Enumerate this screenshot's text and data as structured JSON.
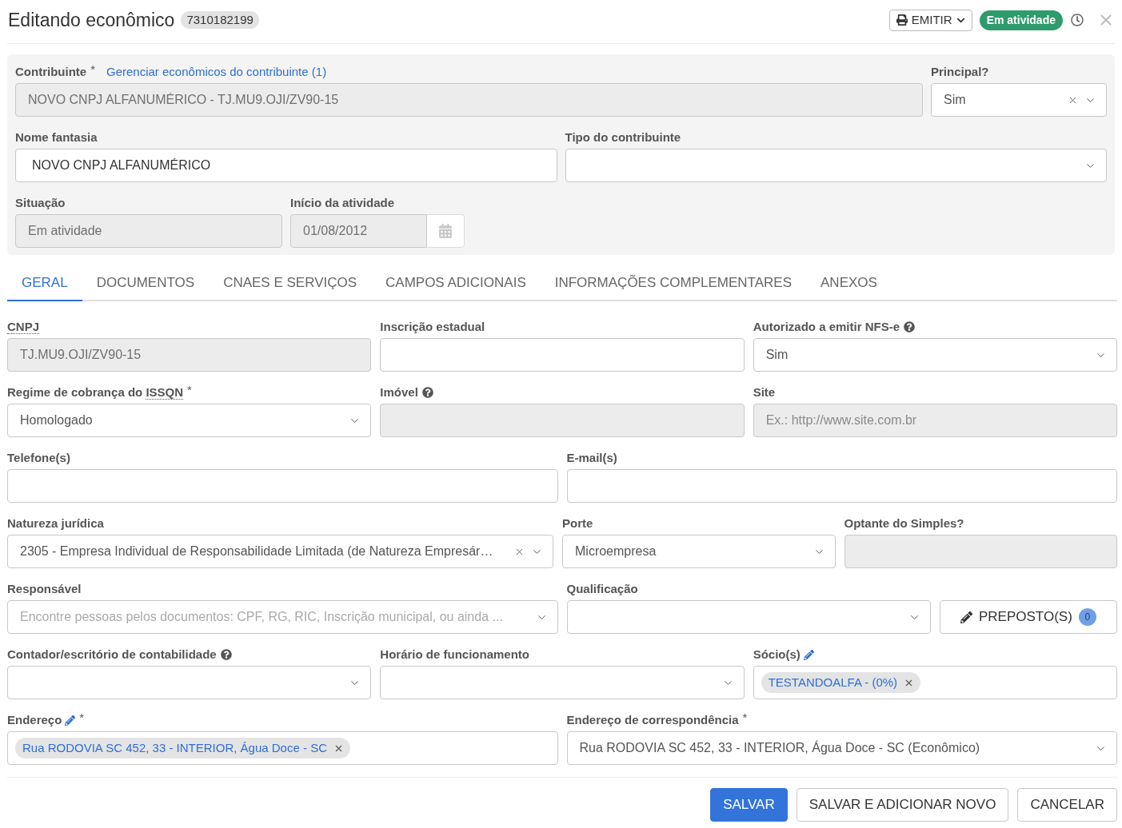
{
  "header": {
    "title": "Editando econômico",
    "record_number": "7310182199",
    "emit_button": "EMITIR",
    "status": "Em atividade"
  },
  "summary_panel": {
    "rows": [
      [
        {
          "kind": "text",
          "label": "Contribuinte",
          "required_mark": "*",
          "link": "Gerenciar econômicos do contribuinte (1)",
          "value": "NOVO CNPJ ALFANUMÉRICO - TJ.MU9.OJI/ZV90-15",
          "disabled": true
        },
        {
          "kind": "select",
          "label": "Principal?",
          "value": "Sim",
          "clearable": true,
          "disabled": false
        }
      ],
      [
        {
          "kind": "text",
          "label": "Nome fantasia",
          "value": "NOVO CNPJ ALFANUMÉRICO",
          "disabled": false
        },
        {
          "kind": "select",
          "label": "Tipo do contribuinte",
          "clearable": false,
          "disabled": false
        }
      ],
      [
        {
          "kind": "text",
          "label": "Situação",
          "value": "Em atividade",
          "disabled": true
        },
        {
          "kind": "date",
          "label": "Início da atividade",
          "value": "01/08/2012",
          "disabled": true
        }
      ]
    ]
  },
  "tabs": [
    {
      "label": "GERAL",
      "selected": true
    },
    {
      "label": "DOCUMENTOS",
      "selected": false
    },
    {
      "label": "CNAES E SERVIÇOS",
      "selected": false
    },
    {
      "label": "CAMPOS ADICIONAIS",
      "selected": false
    },
    {
      "label": "INFORMAÇÕES COMPLEMENTARES",
      "selected": false
    },
    {
      "label": "ANEXOS",
      "selected": false
    }
  ],
  "form": {
    "rows": [
      [
        {
          "kind": "text",
          "abbr": "CNPJ",
          "value": "TJ.MU9.OJI/ZV90-15",
          "disabled": true
        },
        {
          "kind": "text",
          "label": "Inscrição estadual",
          "disabled": false
        },
        {
          "kind": "select",
          "label": "Autorizado a emitir NFS-e",
          "help": true,
          "value": "Sim",
          "clearable": false,
          "disabled": false
        }
      ],
      [
        {
          "kind": "select",
          "label": "Regime de cobrança do",
          "abbr": "ISSQN",
          "required_mark": "*",
          "value": "Homologado",
          "clearable": false,
          "disabled": false
        },
        {
          "kind": "text",
          "label": "Imóvel",
          "help": true,
          "disabled": true
        },
        {
          "kind": "text",
          "label": "Site",
          "placeholder": "Ex.: http://www.site.com.br",
          "disabled": true
        }
      ],
      [
        {
          "kind": "text",
          "label": "Telefone(s)",
          "disabled": false
        },
        {
          "kind": "text",
          "label": "E-mail(s)",
          "disabled": false
        }
      ],
      [
        {
          "kind": "select",
          "label": "Natureza jurídica",
          "value": "2305 - Empresa Individual de Responsabilidade Limitada (de Natureza Empresár…",
          "clearable": true,
          "disabled": false
        },
        {
          "kind": "select",
          "label": "Porte",
          "value": "Microempresa",
          "clearable": false,
          "disabled": false
        },
        {
          "kind": "text",
          "label": "Optante do Simples?",
          "disabled": true
        }
      ],
      [
        {
          "kind": "select",
          "label": "Responsável",
          "placeholder": "Encontre pessoas pelos documentos: CPF, RG, RIC, Inscrição municipal, ou ainda ...",
          "clearable": false,
          "disabled": false
        },
        {
          "kind": "select",
          "label": "Qualificação",
          "clearable": false,
          "disabled": false
        },
        {
          "kind": "button",
          "text": "PREPOSTO(S)",
          "count": "0"
        }
      ],
      [
        {
          "kind": "select",
          "label": "Contador/escritório de contabilidade",
          "help": true,
          "clearable": false,
          "disabled": false
        },
        {
          "kind": "select",
          "label": "Horário de funcionamento",
          "clearable": false,
          "disabled": false
        },
        {
          "kind": "tags",
          "label": "Sócio(s)",
          "edit": true,
          "tags": [
            "TESTANDOALFA - (0%)"
          ],
          "disabled": false
        }
      ],
      [
        {
          "kind": "tags",
          "label": "Endereço",
          "edit": true,
          "required_mark": "*",
          "tags": [
            "Rua RODOVIA SC 452, 33 - INTERIOR, Água Doce - SC"
          ],
          "disabled": false
        },
        {
          "kind": "select",
          "label": "Endereço de correspondência",
          "required_mark": "*",
          "value": "Rua RODOVIA SC 452, 33 - INTERIOR, Água Doce - SC (Econômico)",
          "clearable": false,
          "disabled": false
        }
      ]
    ]
  },
  "footer_buttons": [
    {
      "label": "SALVAR",
      "kind": "primary"
    },
    {
      "label": "SALVAR E ADICIONAR NOVO",
      "kind": "default"
    },
    {
      "label": "CANCELAR",
      "kind": "default"
    }
  ]
}
